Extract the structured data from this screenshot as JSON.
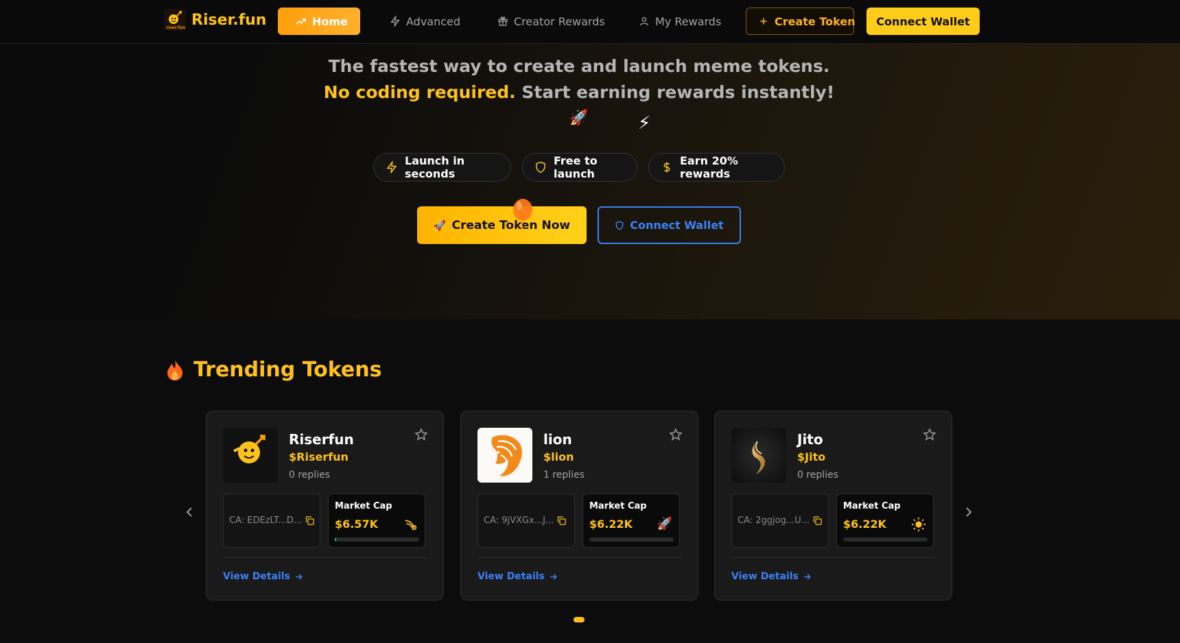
{
  "nav": {
    "brand": "Riser.fun",
    "home": "Home",
    "advanced": "Advanced",
    "creator_rewards": "Creator Rewards",
    "my_rewards": "My Rewards",
    "create_token": "Create Token",
    "connect_wallet": "Connect Wallet"
  },
  "hero": {
    "tagline": "The fastest way to create and launch meme tokens.",
    "highlight": "No coding required.",
    "tagline_rest": " Start earning rewards instantly!",
    "features": [
      "Launch in seconds",
      "Free to launch",
      "Earn 20% rewards"
    ],
    "cta_create": "Create Token Now",
    "cta_connect": "Connect Wallet"
  },
  "trending": {
    "title": "Trending Tokens",
    "tokens": [
      {
        "name": "Riserfun",
        "ticker": "$Riserfun",
        "replies": "0 replies",
        "ca": "CA: EDEzLT...D...",
        "mc_label": "Market Cap",
        "mc_value": "$6.57K",
        "progress": 0.02,
        "view": "View Details"
      },
      {
        "name": "lion",
        "ticker": "$lion",
        "replies": "1 replies",
        "ca": "CA: 9jVXGx...J...",
        "mc_label": "Market Cap",
        "mc_value": "$6.22K",
        "progress": 0.0,
        "view": "View Details"
      },
      {
        "name": "Jito",
        "ticker": "$Jito",
        "replies": "0 replies",
        "ca": "CA: 2ggjog...U...",
        "mc_label": "Market Cap",
        "mc_value": "$6.22K",
        "progress": 0.0,
        "view": "View Details"
      }
    ]
  },
  "colors": {
    "accent": "#ffc21a",
    "orange": "#ff9f0a",
    "link": "#3b82f6"
  }
}
